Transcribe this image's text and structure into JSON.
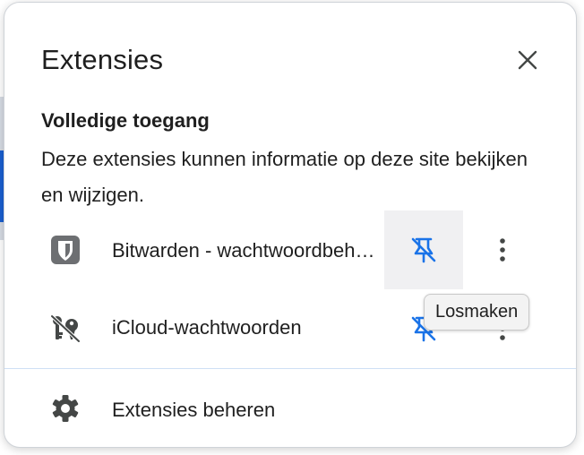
{
  "panel": {
    "title": "Extensies",
    "close_icon": "close-icon"
  },
  "section": {
    "heading": "Volledige toegang",
    "description": "Deze extensies kunnen informatie op deze site bekijken en wijzigen."
  },
  "extensions": [
    {
      "name": "Bitwarden - wachtwoordbeheer",
      "icon": "bitwarden-shield-icon",
      "pin_icon": "unpin-icon",
      "more_icon": "more-vert-icon"
    },
    {
      "name": "iCloud-wachtwoorden",
      "icon": "icloud-passwords-key-icon",
      "pin_icon": "unpin-icon",
      "more_icon": "more-vert-icon"
    }
  ],
  "manage": {
    "label": "Extensies beheren",
    "icon": "gear-icon"
  },
  "tooltip": {
    "text": "Losmaken"
  },
  "colors": {
    "accent": "#1a73e8",
    "text": "#1f1f1f",
    "icon": "#444746",
    "hover": "#f0f0f2",
    "divider": "#cfe0f5"
  }
}
